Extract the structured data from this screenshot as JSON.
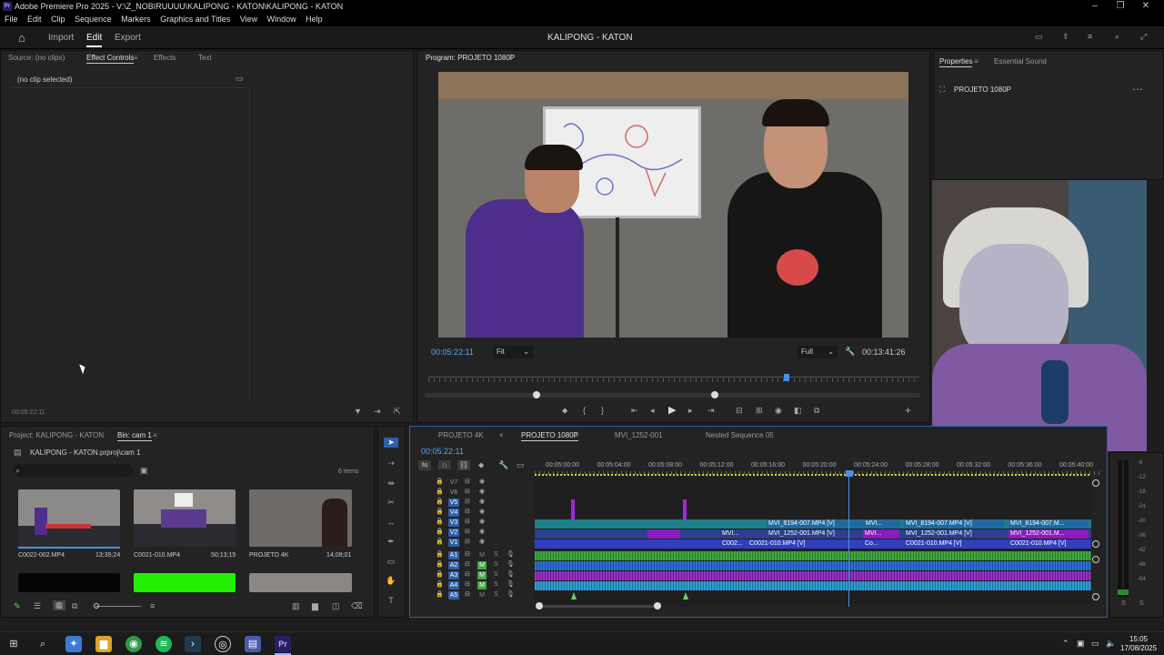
{
  "window": {
    "title": "Adobe Premiere Pro 2025 - V:\\Z_NOBIRUUUU\\KALIPONG - KATON\\KALIPONG - KATON",
    "logo": "Pr"
  },
  "menu": [
    "File",
    "Edit",
    "Clip",
    "Sequence",
    "Markers",
    "Graphics and Titles",
    "View",
    "Window",
    "Help"
  ],
  "workspace": {
    "tabs": [
      "Import",
      "Edit",
      "Export"
    ],
    "active": "Edit",
    "project_title": "KALIPONG - KATON"
  },
  "source_panel": {
    "tabs": [
      "Source: (no clips)",
      "Effect Controls",
      "Effects",
      "Text"
    ],
    "no_clip": "(no clip selected)",
    "timecode": "00:05:22:11"
  },
  "program_monitor": {
    "title": "Program: PROJETO 1080P",
    "timecode": "00:05:22:11",
    "zoom": "Fit",
    "quality": "Full",
    "duration": "00:13:41:26"
  },
  "properties_panel": {
    "tabs": [
      "Properties",
      "Essential Sound"
    ],
    "sequence_name": "PROJETO 1080P"
  },
  "project_panel": {
    "tabs": [
      "Project: KALIPONG - KATON",
      "Bin: cam 1"
    ],
    "path": "KALIPONG - KATON.prproj\\cam 1",
    "item_count": "6 items",
    "items": [
      {
        "name": "C0022-002.MP4",
        "duration": "13;35;24"
      },
      {
        "name": "C0021-010.MP4",
        "duration": "50;13;15"
      },
      {
        "name": "PROJETO 4K",
        "duration": "14;08;01"
      }
    ]
  },
  "timeline": {
    "tabs": [
      "PROJETO 4K",
      "PROJETO 1080P",
      "MVI_1252-001",
      "Nested Sequence 05"
    ],
    "active_tab": "PROJETO 1080P",
    "timecode": "00:05:22:11",
    "ruler": [
      "00:05:00:00",
      "00:05:04:00",
      "00:05:08:00",
      "00:05:12:00",
      "00:05:16:00",
      "00:05:20:00",
      "00:05:24:00",
      "00:05:28:00",
      "00:05:32:00",
      "00:05:36:00",
      "00:05:40:00"
    ],
    "video_tracks": [
      "V7",
      "V6",
      "V5",
      "V4",
      "V3",
      "V2",
      "V1"
    ],
    "audio_tracks": [
      "A1",
      "A2",
      "A3",
      "A4",
      "A5"
    ],
    "clips": {
      "v3a": "MVI_8194-007.MP4 [V]",
      "v3b": "MVI...",
      "v3c": "MVI_8194-007.MP4 [V]",
      "v3d": "MVI_8194-007.M...",
      "v2a": "MVI...",
      "v2b": "MVI_1252-001.MP4 [V]",
      "v2c": "MVI...",
      "v2d": "MVI_1252-001.MP4 [V]",
      "v2e": "MVI_1252-001.M...",
      "v1a": "C002...",
      "v1b": "C0021-010.MP4 [V]",
      "v1c": "Co...",
      "v1d": "C0021-010.MP4 [V]",
      "v1e": "C0021-010.MP4 [V]"
    },
    "meter_scale": [
      "-6",
      "-12",
      "-18",
      "-24",
      "-30",
      "-36",
      "-42",
      "-48",
      "-54"
    ],
    "meter_solo": [
      "S",
      "S"
    ]
  },
  "clock": {
    "time": "15:05",
    "date": "17/08/2025"
  }
}
